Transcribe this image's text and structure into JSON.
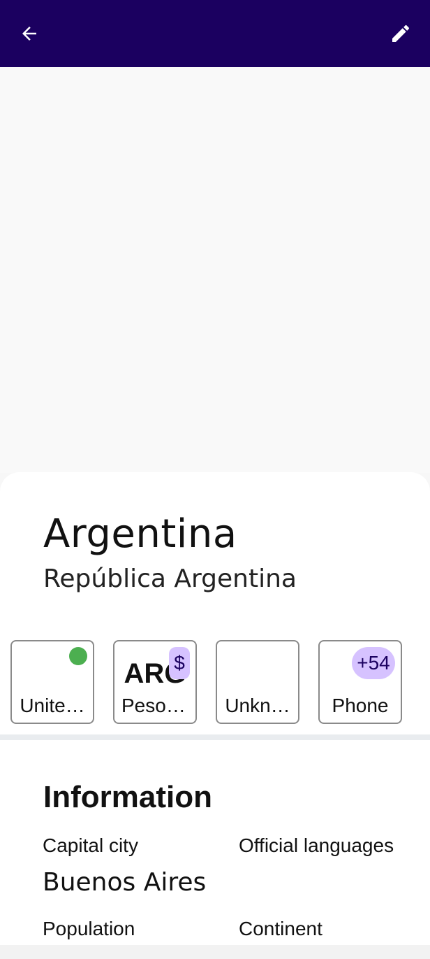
{
  "appbar": {
    "back_icon": "arrow-back-icon",
    "edit_icon": "pencil-icon",
    "color": "#1b0060"
  },
  "country": {
    "name": "Argentina",
    "official_name": "República Argentina"
  },
  "chips": [
    {
      "label": "Unite…",
      "badge": "green-dot",
      "badge_color": "#4caf50"
    },
    {
      "label": "Peso …",
      "big": "ARG",
      "badge": "$"
    },
    {
      "label": "Unkn…"
    },
    {
      "label": "Phone",
      "badge": "+54"
    }
  ],
  "info": {
    "title": "Information",
    "capital_label": "Capital city",
    "capital_value": "Buenos Aires",
    "languages_label": "Official languages",
    "population_label": "Population",
    "continent_label": "Continent"
  },
  "colors": {
    "accent_badge": "#d6c2ff",
    "status_green": "#4caf50"
  }
}
